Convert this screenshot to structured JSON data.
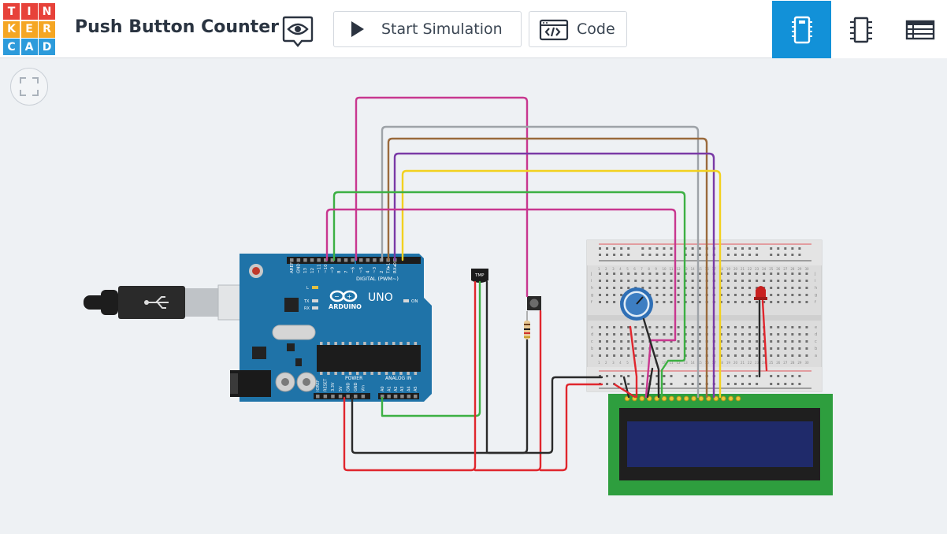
{
  "app": {
    "logo_letters": [
      "T",
      "I",
      "N",
      "K",
      "E",
      "R",
      "C",
      "A",
      "D"
    ],
    "logo_colors": [
      "#e7423a",
      "#e7423a",
      "#e7423a",
      "#f5a623",
      "#f5a623",
      "#f5a623",
      "#2d9bdb",
      "#2d9bdb",
      "#2d9bdb"
    ],
    "title": "Push Button Counter"
  },
  "toolbar": {
    "start_simulation_label": "Start Simulation",
    "code_label": "Code",
    "active_view": "components",
    "accent_color": "#1291d8"
  },
  "circuit": {
    "arduino": {
      "brand": "ARDUINO",
      "model": "UNO",
      "header_digital": "DIGITAL (PWM~)",
      "header_power": "POWER",
      "header_analog": "ANALOG IN",
      "on_label": "ON",
      "tx_label": "TX",
      "rx_label": "RX",
      "l_label": "L",
      "digital_pins": [
        "AREF",
        "GND",
        "13",
        "12",
        "~11",
        "~10",
        "~9",
        "8",
        "7",
        "~6",
        "~5",
        "4",
        "~3",
        "2",
        "TX▸1",
        "RX◂0"
      ],
      "power_pins": [
        "IOREF",
        "RESET",
        "3.3V",
        "5V",
        "GND",
        "GND",
        "Vin"
      ],
      "analog_pins": [
        "A0",
        "A1",
        "A2",
        "A3",
        "A4",
        "A5"
      ]
    },
    "sensor_label": "TMP",
    "breadboard": {
      "row_letters_top": [
        "j",
        "i",
        "h",
        "g",
        "f"
      ],
      "row_letters_bottom": [
        "e",
        "d",
        "c",
        "b",
        "a"
      ],
      "columns": [
        "1",
        "2",
        "3",
        "4",
        "5",
        "6",
        "7",
        "8",
        "9",
        "10",
        "11",
        "12",
        "13",
        "14",
        "15",
        "16",
        "17",
        "18",
        "19",
        "20",
        "21",
        "22",
        "23",
        "24",
        "25",
        "26",
        "27",
        "28",
        "29",
        "30"
      ]
    },
    "wire_colors": {
      "magenta": "#c8378f",
      "gray": "#9ea3a8",
      "brown": "#9a6a3c",
      "purple": "#7a3aa6",
      "yellow": "#f2d11f",
      "green": "#3cb043",
      "red": "#e0262d",
      "black": "#2a2a2a"
    }
  }
}
